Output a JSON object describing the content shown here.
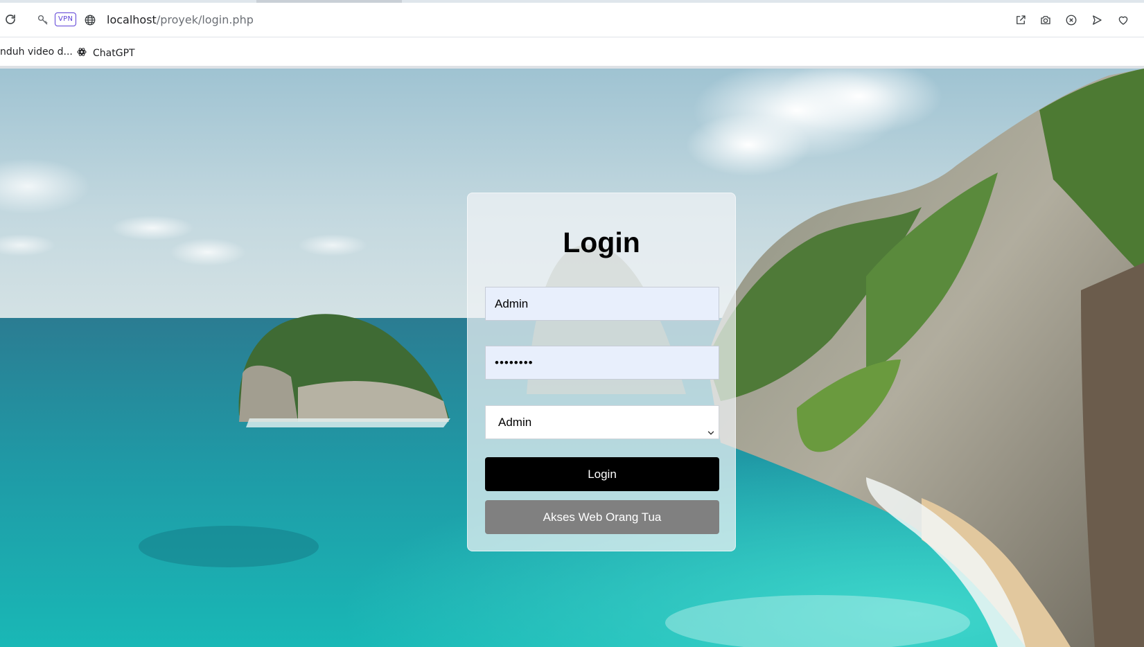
{
  "browser": {
    "vpn_label": "VPN",
    "url_host": "localhost",
    "url_path": "/proyek/login.php",
    "toolbar_icons": [
      "reload-icon",
      "key-icon",
      "globe-icon",
      "share-icon",
      "camera-icon",
      "shield-x-icon",
      "send-icon",
      "heart-icon"
    ]
  },
  "bookmarks": {
    "items": [
      {
        "label": "nduh video d..."
      },
      {
        "label": "ChatGPT",
        "icon": "chatgpt-icon"
      }
    ]
  },
  "login": {
    "title": "Login",
    "username_value": "Admin",
    "password_value": "••••••••",
    "role_selected": "Admin",
    "login_button": "Login",
    "parent_button": "Akses Web Orang Tua"
  },
  "colors": {
    "login_button": "#000000",
    "parent_button": "#808080",
    "input_fill": "#e8effc",
    "vpn_accent": "#5b3fd6"
  }
}
